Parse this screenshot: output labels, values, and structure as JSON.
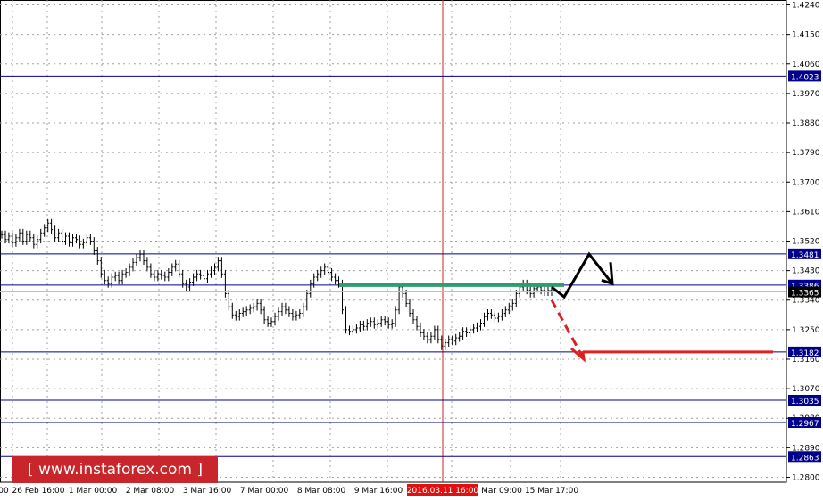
{
  "chart_data": {
    "type": "candlestick",
    "instrument_chart": "price chart",
    "y_axis": {
      "ylim": [
        1.2785,
        1.4255
      ],
      "tick_labels": [
        "1.4240",
        "1.4150",
        "1.4060",
        "1.3970",
        "1.3880",
        "1.3790",
        "1.3700",
        "1.3610",
        "1.3520",
        "1.3430",
        "1.3340",
        "1.3250",
        "1.3160",
        "1.3070",
        "1.2980",
        "1.2890",
        "1.2800"
      ],
      "tick_values": [
        1.424,
        1.415,
        1.406,
        1.397,
        1.388,
        1.379,
        1.37,
        1.361,
        1.352,
        1.343,
        1.334,
        1.325,
        1.316,
        1.307,
        1.298,
        1.289,
        1.28
      ]
    },
    "x_axis": {
      "tick_labels": [
        "00",
        "26 Feb 16:00",
        "1 Mar 00:00",
        "2 Mar 08:00",
        "3 Mar 16:00",
        "7 Mar 00:00",
        "8 Mar 08:00",
        "9 Mar 16:00",
        "2016.03.11 16:00",
        "Mar 09:00",
        "15 Mar 17:00"
      ],
      "highlighted_label": "2016.03.11 16:00"
    },
    "grid": true,
    "levels": [
      {
        "value": 1.4023,
        "label": "1.4023",
        "color": "#00008b"
      },
      {
        "value": 1.3481,
        "label": "1.3481",
        "color": "#00008b"
      },
      {
        "value": 1.3386,
        "label": "1.3386",
        "color": "#00008b"
      },
      {
        "value": 1.3182,
        "label": "1.3182",
        "color": "#00008b"
      },
      {
        "value": 1.3035,
        "label": "1.3035",
        "color": "#00008b"
      },
      {
        "value": 1.2967,
        "label": "1.2967",
        "color": "#00008b"
      },
      {
        "value": 1.2863,
        "label": "1.2863",
        "color": "#00008b"
      }
    ],
    "current_price": {
      "value": 1.3365,
      "label": "1.3365"
    },
    "price_series": [
      1.354,
      1.3525,
      1.3535,
      1.3515,
      1.353,
      1.3545,
      1.352,
      1.354,
      1.353,
      1.351,
      1.3525,
      1.3545,
      1.356,
      1.3575,
      1.3555,
      1.353,
      1.3545,
      1.352,
      1.3535,
      1.3515,
      1.353,
      1.3525,
      1.351,
      1.3515,
      1.353,
      1.352,
      1.349,
      1.346,
      1.342,
      1.34,
      1.339,
      1.341,
      1.3415,
      1.34,
      1.342,
      1.3425,
      1.344,
      1.3455,
      1.347,
      1.348,
      1.346,
      1.344,
      1.342,
      1.341,
      1.342,
      1.3415,
      1.341,
      1.3425,
      1.344,
      1.345,
      1.342,
      1.339,
      1.338,
      1.3395,
      1.341,
      1.342,
      1.3415,
      1.3405,
      1.342,
      1.343,
      1.344,
      1.346,
      1.342,
      1.336,
      1.332,
      1.3295,
      1.329,
      1.33,
      1.3305,
      1.331,
      1.3315,
      1.332,
      1.333,
      1.331,
      1.328,
      1.327,
      1.3275,
      1.329,
      1.3305,
      1.332,
      1.331,
      1.33,
      1.329,
      1.3295,
      1.33,
      1.332,
      1.336,
      1.339,
      1.341,
      1.342,
      1.343,
      1.344,
      1.3425,
      1.341,
      1.34,
      1.339,
      1.331,
      1.325,
      1.3245,
      1.325,
      1.3255,
      1.3265,
      1.326,
      1.327,
      1.3275,
      1.3265,
      1.327,
      1.328,
      1.3275,
      1.3265,
      1.327,
      1.331,
      1.338,
      1.336,
      1.333,
      1.33,
      1.328,
      1.326,
      1.324,
      1.323,
      1.322,
      1.323,
      1.325,
      1.322,
      1.32,
      1.321,
      1.322,
      1.3215,
      1.3225,
      1.323,
      1.3245,
      1.324,
      1.325,
      1.3255,
      1.326,
      1.327,
      1.329,
      1.33,
      1.3295,
      1.3285,
      1.329,
      1.33,
      1.331,
      1.332,
      1.333,
      1.336,
      1.338,
      1.339,
      1.337,
      1.336,
      1.3375,
      1.338,
      1.337,
      1.3365,
      1.337,
      1.3365
    ],
    "resistance_line": {
      "value": 1.3386,
      "color": "#2e9e6e"
    },
    "scenarios": [
      {
        "direction": "up",
        "color": "#000000",
        "path_values": [
          1.338,
          1.335,
          1.348,
          1.339
        ]
      },
      {
        "direction": "down",
        "color": "#e02020",
        "path_values": [
          1.334,
          1.324,
          1.316
        ],
        "target_level": 1.3182
      }
    ]
  },
  "watermark": {
    "text": "[ www.instaforex.com ]"
  }
}
